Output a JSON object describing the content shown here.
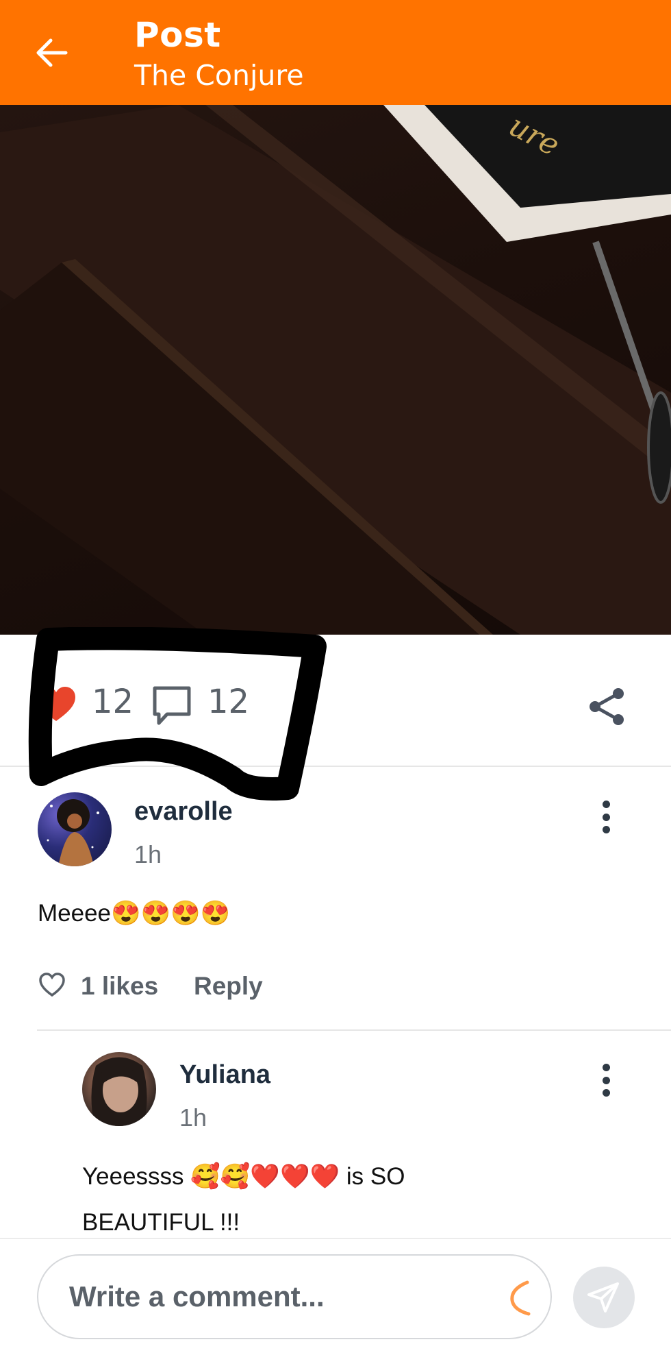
{
  "header": {
    "title": "Post",
    "subtitle": "The Conjure"
  },
  "post": {
    "image_description_icon": "photo-image",
    "like_count": "12",
    "comment_count": "12"
  },
  "comments": [
    {
      "username": "evarolle",
      "time": "1h",
      "text": "Meeee😍😍😍😍",
      "likes_label": "1 likes",
      "reply_label": "Reply"
    },
    {
      "username": "Yuliana",
      "time": "1h",
      "text": "Yeeessss 🥰🥰❤️❤️❤️  is SO BEAUTIFUL !!!"
    }
  ],
  "composer": {
    "placeholder": "Write a comment..."
  },
  "colors": {
    "brand": "#ff7300",
    "like_red": "#e8452c"
  }
}
